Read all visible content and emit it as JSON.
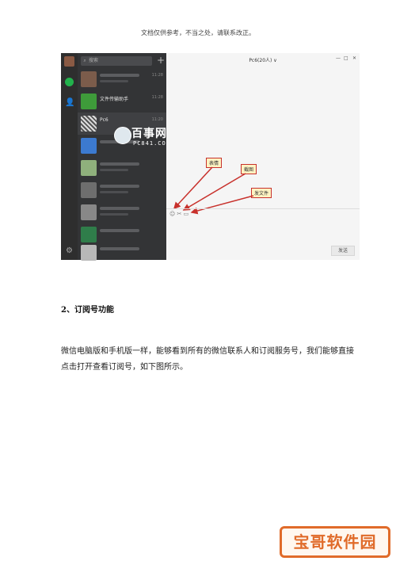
{
  "header_note": "文档仅供参考，不当之处，请联系改正。",
  "screenshot": {
    "search_placeholder": "搜索",
    "plus_icon": "+",
    "chat_title": "Pc6(20人) ∨",
    "window_controls": [
      "—",
      "□",
      "✕"
    ],
    "list_items": [
      {
        "name": "",
        "time": "11:28"
      },
      {
        "name": "文件传输助手",
        "time": "11:28"
      },
      {
        "name": "Pc6",
        "time": "11:20"
      },
      {
        "name": "",
        "time": ""
      },
      {
        "name": "",
        "time": ""
      },
      {
        "name": "",
        "time": ""
      },
      {
        "name": "",
        "time": ""
      },
      {
        "name": "",
        "time": ""
      },
      {
        "name": "",
        "time": ""
      }
    ],
    "watermark_title": "百事网",
    "watermark_sub": "PC841.COM",
    "callouts": {
      "emoji": "表情",
      "screenshot": "截图",
      "send_file": "发文件"
    },
    "tool_icons": "☺ ✂ ▭",
    "send_button": "发送"
  },
  "section_heading": "2、订阅号功能",
  "paragraph": "微信电脑版和手机版一样，能够看到所有的微信联系人和订阅服务号，我们能够直接点击打开查看订阅号，如下图所示。",
  "brand": "宝哥软件园",
  "colors": {
    "accent_green": "#22b24c",
    "callout_border": "#c8312c",
    "brand_orange": "#e06b2a"
  }
}
